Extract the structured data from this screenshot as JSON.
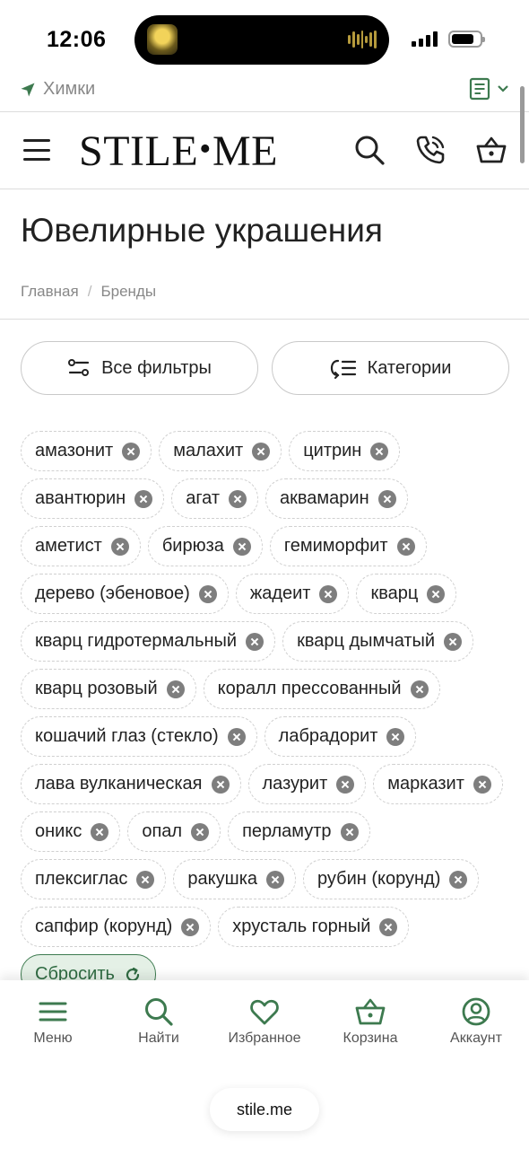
{
  "status_bar": {
    "time": "12:06"
  },
  "location": {
    "city": "Химки"
  },
  "header": {
    "logo_left": "STILE",
    "logo_dot": "•",
    "logo_right": "ME"
  },
  "page": {
    "title": "Ювелирные украшения",
    "breadcrumbs": [
      "Главная",
      "/",
      "Бренды"
    ]
  },
  "filters": {
    "all_filters_label": "Все фильтры",
    "categories_label": "Категории"
  },
  "chips": [
    "амазонит",
    "малахит",
    "цитрин",
    "авантюрин",
    "агат",
    "аквамарин",
    "аметист",
    "бирюза",
    "гемиморфит",
    "дерево (эбеновое)",
    "жадеит",
    "кварц",
    "кварц гидротермальный",
    "кварц дымчатый",
    "кварц розовый",
    "коралл прессованный",
    "кошачий глаз (стекло)",
    "лабрадорит",
    "лава вулканическая",
    "лазурит",
    "марказит",
    "оникс",
    "опал",
    "перламутр",
    "плексиглас",
    "ракушка",
    "рубин (корунд)",
    "сапфир (корунд)",
    "хрусталь горный"
  ],
  "reset_label": "Сбросить",
  "bottom_nav": {
    "menu": "Меню",
    "search": "Найти",
    "favorites": "Избранное",
    "cart": "Корзина",
    "account": "Аккаунт"
  },
  "browser": {
    "url": "stile.me"
  },
  "colors": {
    "accent_green": "#3d7a4f",
    "reset_bg": "#e4f0e6",
    "text": "#222222",
    "muted": "#888888"
  }
}
